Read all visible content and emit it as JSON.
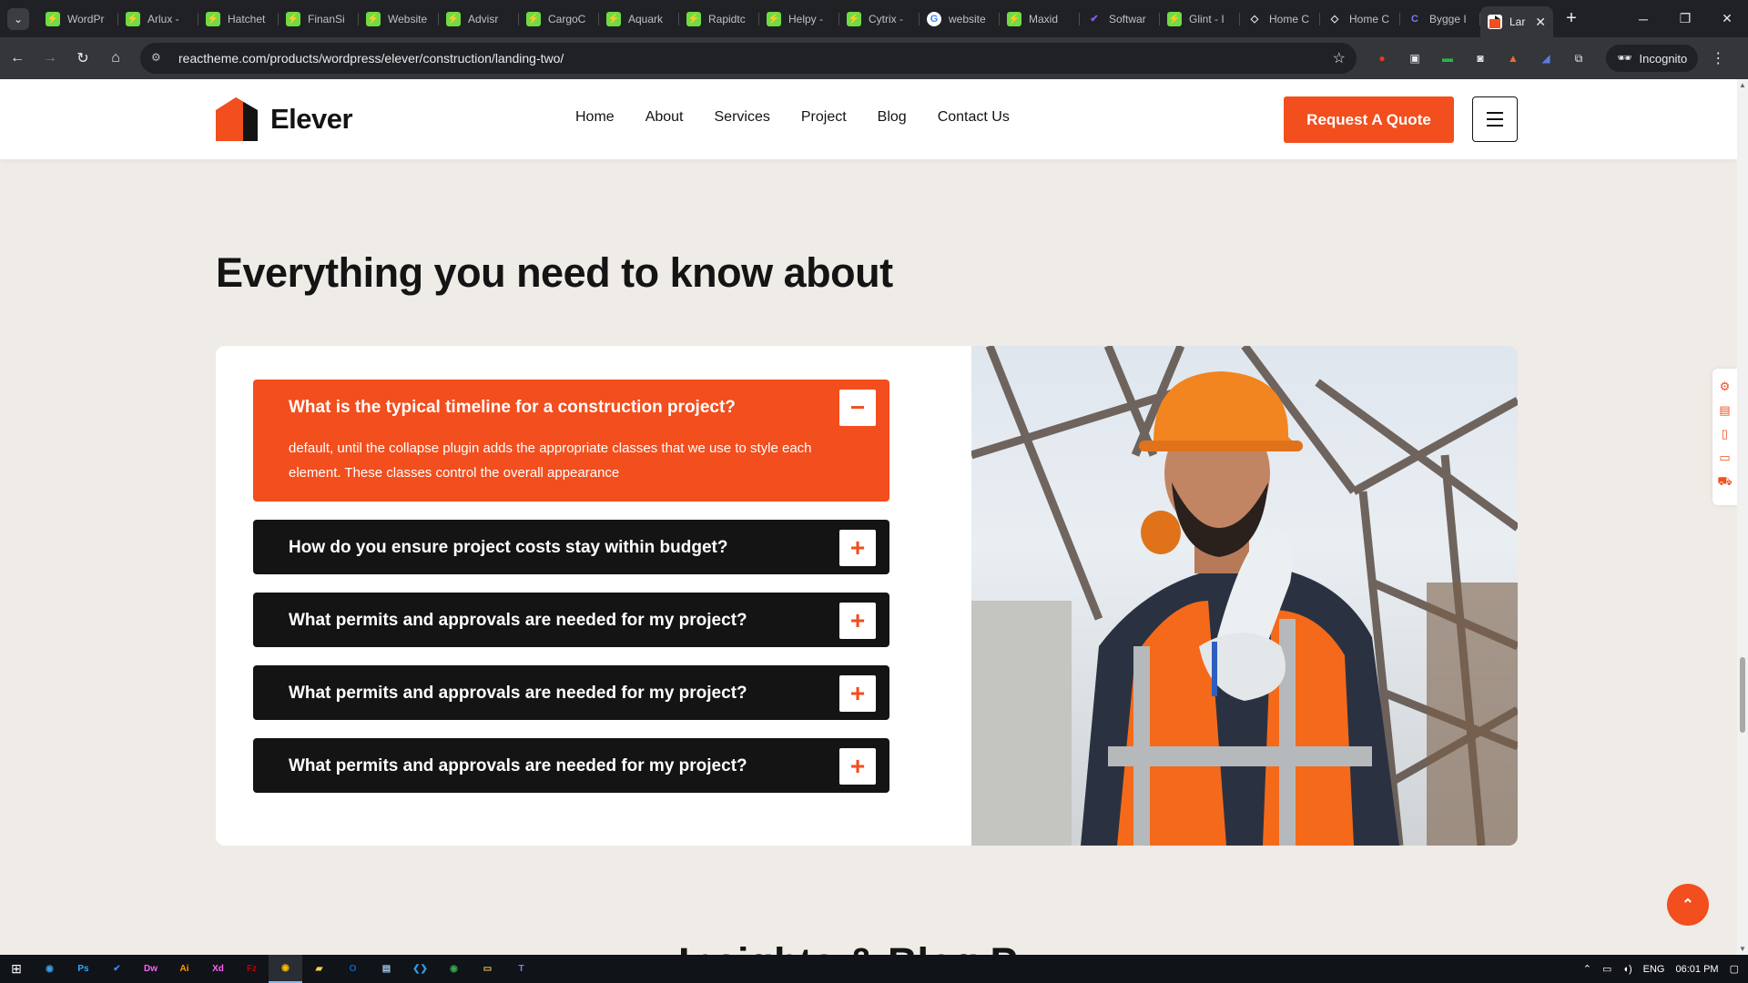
{
  "browser": {
    "tabs": [
      {
        "title": "WordPr",
        "favicon": "fav-green",
        "glyph": "⚡"
      },
      {
        "title": "Arlux -",
        "favicon": "fav-green",
        "glyph": "⚡"
      },
      {
        "title": "Hatchet",
        "favicon": "fav-green",
        "glyph": "⚡"
      },
      {
        "title": "FinanSi",
        "favicon": "fav-green",
        "glyph": "⚡"
      },
      {
        "title": "Website",
        "favicon": "fav-green",
        "glyph": "⚡"
      },
      {
        "title": "Advisr",
        "favicon": "fav-green",
        "glyph": "⚡"
      },
      {
        "title": "CargoC",
        "favicon": "fav-green",
        "glyph": "⚡"
      },
      {
        "title": "Aquark",
        "favicon": "fav-green",
        "glyph": "⚡"
      },
      {
        "title": "Rapidtc",
        "favicon": "fav-green",
        "glyph": "⚡"
      },
      {
        "title": "Helpy -",
        "favicon": "fav-green",
        "glyph": "⚡"
      },
      {
        "title": "Cytrix -",
        "favicon": "fav-green",
        "glyph": "⚡"
      },
      {
        "title": "website",
        "favicon": "fav-google",
        "glyph": "G"
      },
      {
        "title": "Maxid",
        "favicon": "fav-green",
        "glyph": "⚡"
      },
      {
        "title": "Softwar",
        "favicon": "fav-purple",
        "glyph": "✔"
      },
      {
        "title": "Glint - I",
        "favicon": "fav-green",
        "glyph": "⚡"
      },
      {
        "title": "Home C",
        "favicon": "fav-diamond",
        "glyph": "◇"
      },
      {
        "title": "Home C",
        "favicon": "fav-diamond",
        "glyph": "◇"
      },
      {
        "title": "Bygge I",
        "favicon": "fav-c",
        "glyph": "C"
      }
    ],
    "active_tab": {
      "title": "Lar",
      "close": "✕"
    },
    "new_tab": "+",
    "window_controls": {
      "minimize": "─",
      "restore": "❐",
      "close": "✕"
    },
    "url": "reactheme.com/products/wordpress/elever/construction/landing-two/",
    "incognito_label": "Incognito"
  },
  "site": {
    "logo_text": "Elever",
    "nav": [
      "Home",
      "About",
      "Services",
      "Project",
      "Blog",
      "Contact Us"
    ],
    "cta": "Request A Quote"
  },
  "faq": {
    "title": "Everything you need to know about",
    "items": [
      {
        "question": "What is the typical timeline for a construction project?",
        "answer": "default, until the collapse plugin adds the appropriate classes that we use to style each element. These classes control the overall appearance",
        "toggle": "−",
        "open": true
      },
      {
        "question": "How do you ensure project costs stay within budget?",
        "toggle": "+"
      },
      {
        "question": "What permits and approvals are needed for my project?",
        "toggle": "+"
      },
      {
        "question": "What permits and approvals are needed for my project?",
        "toggle": "+"
      },
      {
        "question": "What permits and approvals are needed for my project?",
        "toggle": "+"
      }
    ]
  },
  "next_section_heading_partial": "Insights & Blog P",
  "taskbar": {
    "language": "ENG",
    "time": "06:01 PM"
  },
  "colors": {
    "accent": "#f24e1e",
    "dark": "#141414"
  }
}
